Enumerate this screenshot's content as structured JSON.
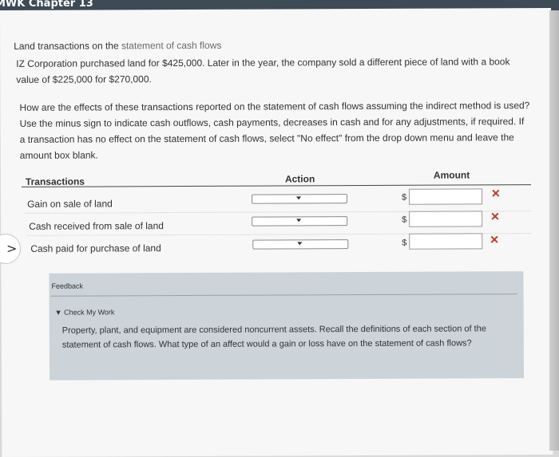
{
  "header": {
    "title": "MWK Chapter 13"
  },
  "question": {
    "heading_prefix": "Land transactions on the ",
    "heading_link": "statement of cash flows",
    "paragraph1": "IZ Corporation purchased land for $425,000. Later in the year, the company sold a different piece of land with a book value of $225,000 for $270,000.",
    "paragraph2": "How are the effects of these transactions reported on the statement of cash flows assuming the indirect method is used? Use the minus sign to indicate cash outflows, cash payments, decreases in cash and for any adjustments, if required. If a transaction has no effect on the statement of cash flows, select \"No effect\" from the drop down menu and leave the amount box blank."
  },
  "table": {
    "headers": {
      "transactions": "Transactions",
      "action": "Action",
      "amount": "Amount"
    },
    "currency_symbol": "$",
    "rows": [
      {
        "label": "Gain on sale of land",
        "action": "",
        "amount": "",
        "status": "✕"
      },
      {
        "label": "Cash received from sale of land",
        "action": "",
        "amount": "",
        "status": "✕"
      },
      {
        "label": "Cash paid for purchase of land",
        "action": "",
        "amount": "",
        "status": "✕"
      }
    ]
  },
  "feedback": {
    "title": "Feedback",
    "toggle": "▼ Check My Work",
    "text": "Property, plant, and equipment are considered noncurrent assets. Recall the definitions of each section of the statement of cash flows. What type of an affect would a gain or loss have on the statement of cash flows?"
  },
  "nav": {
    "chevron": ">"
  },
  "colors": {
    "incorrect": "#c0392b",
    "feedback_bg": "#ccd3d9",
    "topbar": "#3e4a55"
  }
}
